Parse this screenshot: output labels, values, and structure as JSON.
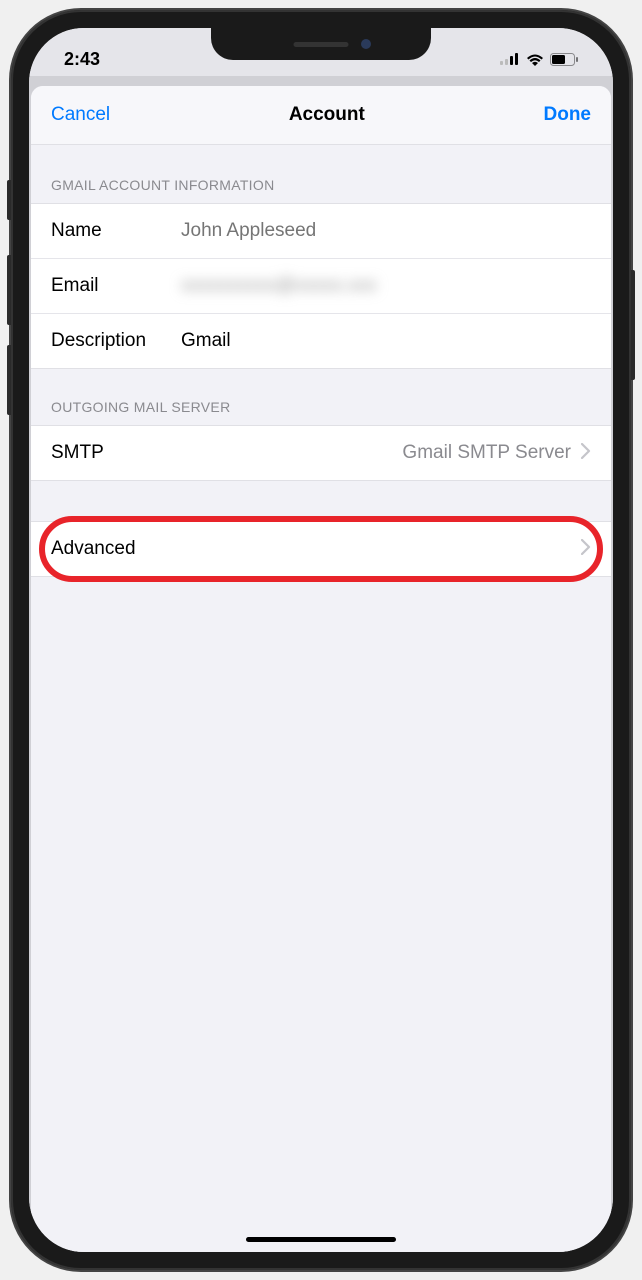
{
  "statusBar": {
    "time": "2:43"
  },
  "nav": {
    "cancel": "Cancel",
    "title": "Account",
    "done": "Done"
  },
  "sections": {
    "info": {
      "header": "GMAIL ACCOUNT INFORMATION",
      "name": {
        "label": "Name",
        "placeholder": "John Appleseed"
      },
      "email": {
        "label": "Email",
        "value": "xxxxxxxxxx@xxxxx.xxx"
      },
      "description": {
        "label": "Description",
        "value": "Gmail"
      }
    },
    "outgoing": {
      "header": "OUTGOING MAIL SERVER",
      "smtp": {
        "label": "SMTP",
        "detail": "Gmail SMTP Server"
      }
    },
    "advanced": {
      "label": "Advanced"
    }
  }
}
